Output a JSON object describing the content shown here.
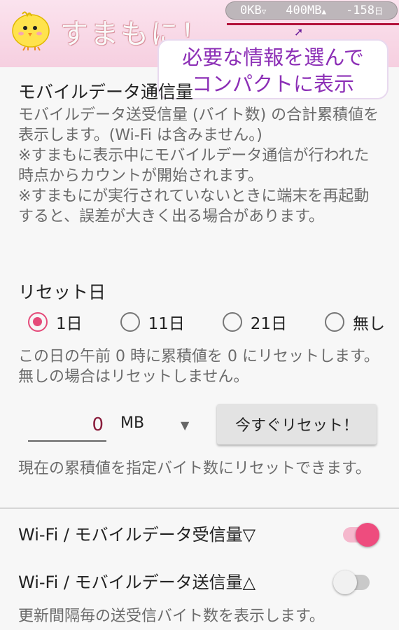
{
  "header": {
    "app_title": "すまもに！",
    "icon": "chick-icon",
    "status": {
      "data_total": "0KB",
      "data_arrow": "▽",
      "limit": "400MB",
      "limit_mark": "▲",
      "remaining": "-158",
      "remaining_unit": "日"
    }
  },
  "callout": {
    "line1": "必要な情報を選んで",
    "line2": "コンパクトに表示"
  },
  "mobile_data": {
    "title": "モバイルデータ通信量",
    "description": "モバイルデータ送受信量 (バイト数) の合計累積値を表示します。(Wi-Fi は含みません。)\n※すまもに表示中にモバイルデータ通信が行われた時点からカウントが開始されます。\n※すまもにが実行されていないときに端末を再起動すると、誤差が大きく出る場合があります。"
  },
  "reset_day": {
    "title": "リセット日",
    "options": [
      "1日",
      "11日",
      "21日",
      "無し"
    ],
    "selected": "1日",
    "description": "この日の午前 0 時に累積値を 0 にリセットします。無しの場合はリセットしません。"
  },
  "reset_now": {
    "value": "0",
    "unit": "MB",
    "dropdown_icon": "▼",
    "button_label": "今すぐリセット！",
    "note": "現在の累積値を指定バイト数にリセットできます。"
  },
  "settings": [
    {
      "label": "Wi-Fi / モバイルデータ受信量▽",
      "enabled": true
    },
    {
      "label": "Wi-Fi / モバイルデータ送信量△",
      "enabled": false,
      "description": "更新間隔毎の送受信バイト数を表示します。"
    }
  ],
  "colors": {
    "accent": "#ee4c7e",
    "header_bg": "#f6cfe0",
    "callout_text": "#8c2fb6"
  }
}
